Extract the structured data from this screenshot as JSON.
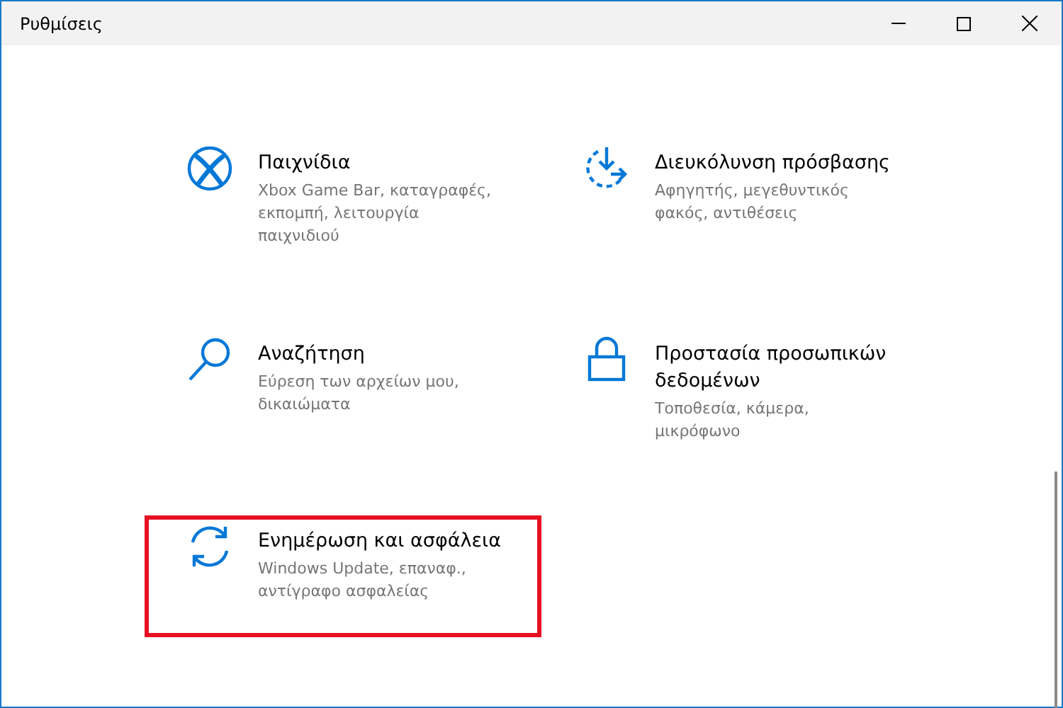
{
  "window": {
    "title": "Ρυθμίσεις"
  },
  "categories": [
    {
      "kind": "xbox",
      "title": "Παιχνίδια",
      "description": "Xbox Game Bar, καταγραφές, εκπομπή, λειτουργία παιχνιδιού",
      "highlighted": false
    },
    {
      "kind": "accessibility",
      "title": "Διευκόλυνση πρόσβασης",
      "description": "Αφηγητής, μεγεθυντικός φακός, αντιθέσεις",
      "highlighted": false
    },
    {
      "kind": "search",
      "title": "Αναζήτηση",
      "description": "Εύρεση των αρχείων μου, δικαιώματα",
      "highlighted": false
    },
    {
      "kind": "lock",
      "title": "Προστασία προσωπικών δεδομένων",
      "description": "Τοποθεσία, κάμερα, μικρόφωνο",
      "highlighted": false
    },
    {
      "kind": "sync",
      "title": "Ενημέρωση και ασφάλεια",
      "description": "Windows Update, επαναφ., αντίγραφο ασφαλείας",
      "highlighted": true
    }
  ]
}
